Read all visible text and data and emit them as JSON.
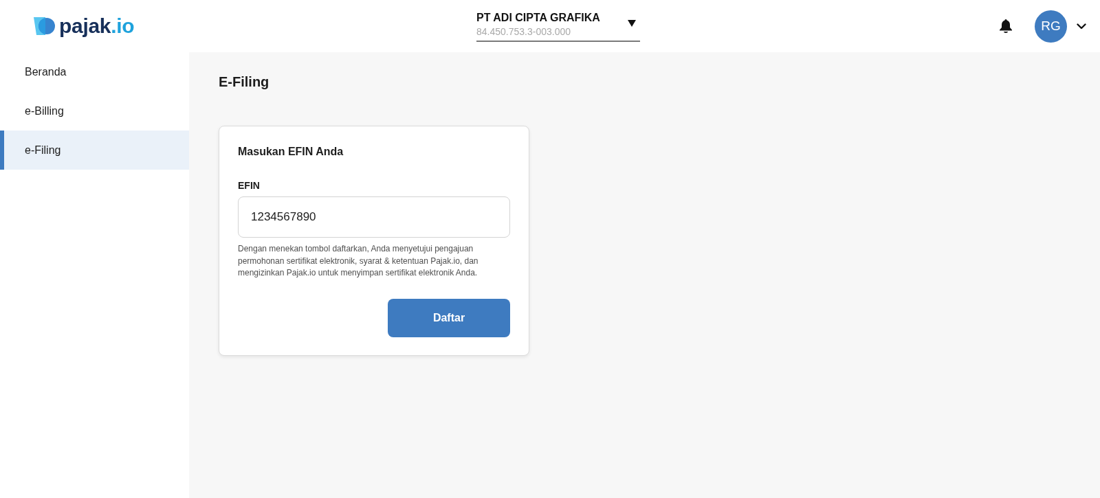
{
  "header": {
    "logo": {
      "name": "pajak",
      "suffix": ".io"
    },
    "company": {
      "name": "PT ADI CIPTA GRAFIKA",
      "npwp": "84.450.753.3-003.000"
    },
    "user": {
      "initials": "RG"
    }
  },
  "sidebar": {
    "items": [
      {
        "label": "Beranda",
        "selected": false
      },
      {
        "label": "e-Billing",
        "selected": false
      },
      {
        "label": "e-Filing",
        "selected": true
      }
    ]
  },
  "page": {
    "title": "E-Filing"
  },
  "card": {
    "title": "Masukan EFIN Anda",
    "field": {
      "label": "EFIN",
      "value": "1234567890"
    },
    "note": "Dengan menekan tombol daftarkan, Anda menyetujui pengajuan permohonan sertifikat elektronik, syarat & ketentuan Pajak.io, dan mengizinkan Pajak.io untuk menyimpan sertifikat elektronik Anda.",
    "button": "Daftar"
  }
}
